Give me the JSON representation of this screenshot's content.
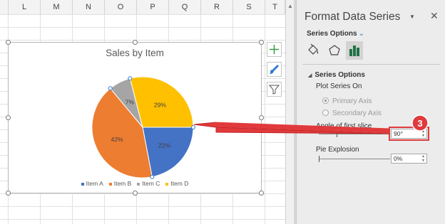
{
  "sheet": {
    "columns": [
      "L",
      "M",
      "N",
      "O",
      "P",
      "Q",
      "R",
      "S",
      "T"
    ]
  },
  "chart": {
    "title": "Sales by Item"
  },
  "chart_data": {
    "type": "pie",
    "title": "Sales by Item",
    "categories": [
      "Item A",
      "Item B",
      "Item C",
      "Item D"
    ],
    "values": [
      22,
      42,
      7,
      29
    ],
    "labels": [
      "22%",
      "42%",
      "7%",
      "29%"
    ],
    "colors": [
      "#4472c4",
      "#ed7d31",
      "#a5a5a5",
      "#ffc000"
    ],
    "start_angle_deg": 90,
    "legend_position": "bottom"
  },
  "pane": {
    "title": "Format Data Series",
    "series_options_dropdown": "Series Options",
    "section_title": "Series Options",
    "plot_series_on": "Plot Series On",
    "primary_axis": "Primary Axis",
    "secondary_axis": "Secondary Axis",
    "angle_label": "Angle of first slice",
    "angle_value": "90°",
    "explosion_label": "Pie Explosion",
    "explosion_value": "0%"
  },
  "callout": {
    "number": "3",
    "color": "#e03a3c"
  }
}
